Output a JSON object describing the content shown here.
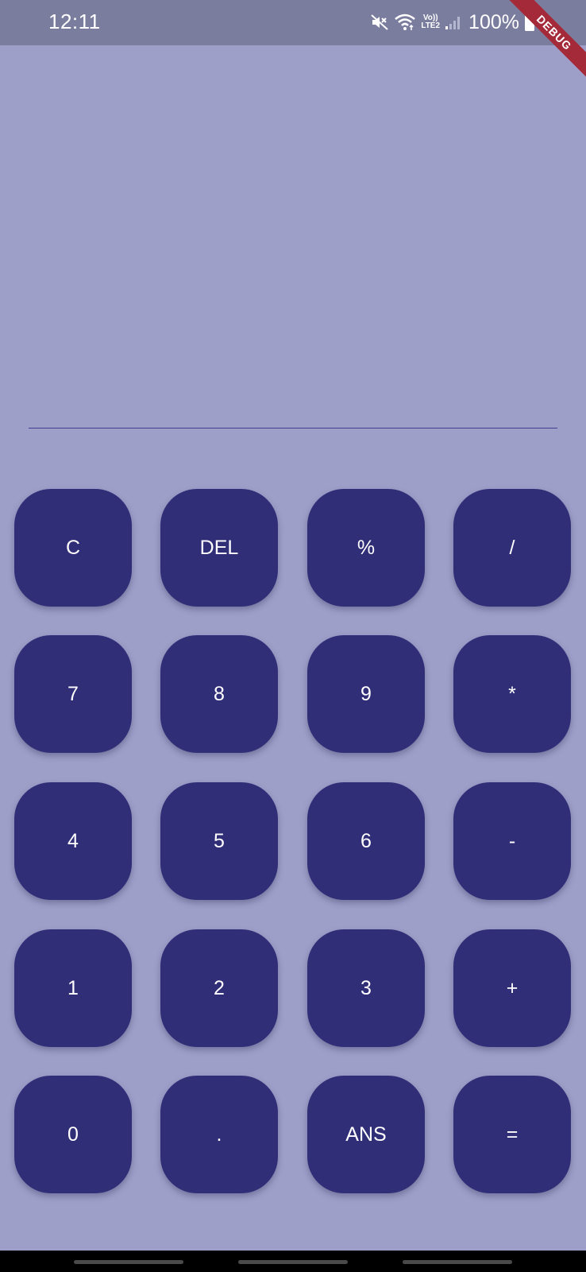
{
  "status_bar": {
    "time": "12:11",
    "volte_top": "Vo))",
    "volte_bottom": "LTE2",
    "battery": "100%"
  },
  "debug_banner": "DEBUG",
  "keypad": {
    "rows": [
      [
        "C",
        "DEL",
        "%",
        "/"
      ],
      [
        "7",
        "8",
        "9",
        "*"
      ],
      [
        "4",
        "5",
        "6",
        "-"
      ],
      [
        "1",
        "2",
        "3",
        "+"
      ],
      [
        "0",
        ".",
        "ANS",
        "="
      ]
    ]
  },
  "colors": {
    "background": "#9d9fc9",
    "status_bar": "#7b7d9f",
    "button": "#312e78",
    "button_text": "#ffffff",
    "divider": "#3f3f8f",
    "debug_ribbon": "#a42a3a"
  }
}
